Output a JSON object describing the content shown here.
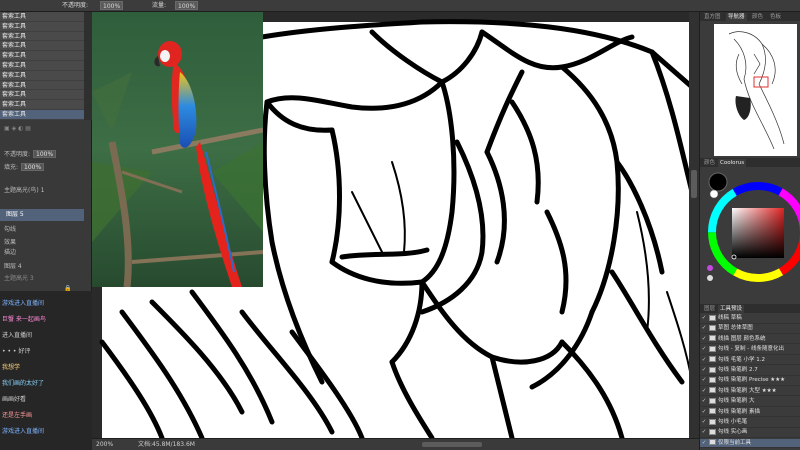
{
  "topbar": {
    "items": [
      "不透明度:",
      "100%",
      "流量:",
      "100%"
    ]
  },
  "left_panel": {
    "history_items": [
      "套索工具",
      "套索工具",
      "套索工具",
      "套索工具",
      "套索工具",
      "套索工具",
      "套索工具",
      "套索工具",
      "套索工具",
      "套索工具",
      "套索工具"
    ],
    "opacity_label": "不透明度:",
    "opacity_value": "100%",
    "fill_label": "填充:",
    "fill_value": "100%",
    "layer_group": "主题高光(鸟) 1",
    "layer_selected": "图层 5",
    "layer_a": "勾线",
    "layer_b": "效果",
    "layer_c": "描边",
    "layer_d": "图层 4",
    "bottom_label": "主题高光 3"
  },
  "chat": {
    "lines": [
      {
        "text": "游戏进入直播间",
        "color": "#7fb3ff"
      },
      {
        "text": "巨蟹 来一起画鸟",
        "color": "#ff8ad8"
      },
      {
        "text": "进入直播间",
        "color": "#cfcfcf"
      },
      {
        "text": "• • • 好评",
        "color": "#cfcfcf"
      },
      {
        "text": "我想学",
        "color": "#ffd27a"
      },
      {
        "text": "我们画的太好了",
        "color": "#8ad4ff"
      },
      {
        "text": "画画好看",
        "color": "#cfcfcf"
      },
      {
        "text": "还是左手画",
        "color": "#ff9a9a"
      },
      {
        "text": "游戏进入直播间",
        "color": "#7fb3ff"
      }
    ]
  },
  "canvas": {
    "zoom": "200%",
    "doc_info": "文档:45.8M/183.6M"
  },
  "right_panel": {
    "top_tabs": [
      "直方图",
      "导航器",
      "颜色",
      "色板"
    ],
    "color_tabs": [
      "颜色",
      "Coolorus"
    ],
    "layer_tabs": [
      "图层",
      "工具预设"
    ],
    "layers": [
      {
        "name": "线稿 草稿",
        "selected": false
      },
      {
        "name": "草图 总体草图",
        "selected": false
      },
      {
        "name": "线描 图层 颜色系统",
        "selected": false
      },
      {
        "name": "勾线 - 复制 - 线条随意化出",
        "selected": false
      },
      {
        "name": "勾线 毛笔 小学 1.2",
        "selected": false
      },
      {
        "name": "勾线 染笔刷 2.7",
        "selected": false
      },
      {
        "name": "勾线 染笔刷 Precise ★★★",
        "selected": false
      },
      {
        "name": "勾线 染笔刷 大型 ★★★",
        "selected": false
      },
      {
        "name": "勾线 染笔刷 大",
        "selected": false
      },
      {
        "name": "勾线 染笔刷 素描",
        "selected": false
      },
      {
        "name": "勾线 小毛笔",
        "selected": false
      },
      {
        "name": "勾线 实心画",
        "selected": false
      },
      {
        "name": "仅限当前工具",
        "selected": true
      }
    ]
  },
  "colors": {
    "foreground": "#000000",
    "background": "#ffffff",
    "selection": "#51627a"
  }
}
